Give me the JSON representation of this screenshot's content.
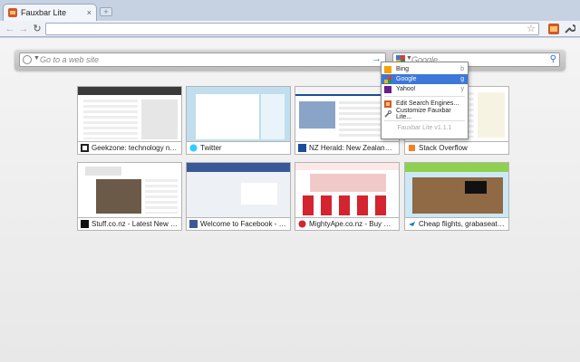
{
  "tab": {
    "title": "Fauxbar Lite",
    "close": "×",
    "new_tab": "+"
  },
  "toolbar": {
    "back": "←",
    "forward": "→",
    "reload": "↻",
    "star": "☆"
  },
  "fauxbar": {
    "address_placeholder": "Go to a web site",
    "search_placeholder": "Google",
    "go_icon": "→",
    "search_icon": "⚲"
  },
  "search_menu": {
    "engines": [
      {
        "label": "Bing",
        "key": "b",
        "selected": false,
        "color": "#f4a300"
      },
      {
        "label": "Google",
        "key": "g",
        "selected": true,
        "color": "#3c78d8"
      },
      {
        "label": "Yahoo!",
        "key": "y",
        "selected": false,
        "color": "#6b1d8a"
      }
    ],
    "actions": [
      {
        "label": "Edit Search Engines...",
        "icon": "engines-icon"
      },
      {
        "label": "Customize Fauxbar Lite...",
        "icon": "wrench-icon"
      }
    ],
    "version": "Fauxbar Lite v1.1.1"
  },
  "tiles": [
    {
      "label": "Geekzone: technology news, bl...",
      "icon": "geekzone-icon",
      "color": "#222222"
    },
    {
      "label": "Twitter",
      "icon": "twitter-icon",
      "color": "#33ccff"
    },
    {
      "label": "NZ Herald: New Zealand's Late...",
      "icon": "nzherald-icon",
      "color": "#1a4d9b"
    },
    {
      "label": "Stack Overflow",
      "icon": "stackoverflow-icon",
      "color": "#f48024"
    },
    {
      "label": "Stuff.co.nz - Latest New Zealan...",
      "icon": "stuff-icon",
      "color": "#111111"
    },
    {
      "label": "Welcome to Facebook - Log In...",
      "icon": "facebook-icon",
      "color": "#3b5998"
    },
    {
      "label": "MightyApe.co.nz - Buy Games,...",
      "icon": "mightyape-icon",
      "color": "#d3242f"
    },
    {
      "label": "Cheap flights, grabaseat - ho...",
      "icon": "grabaseat-icon",
      "color": "#1f7fbf"
    }
  ]
}
